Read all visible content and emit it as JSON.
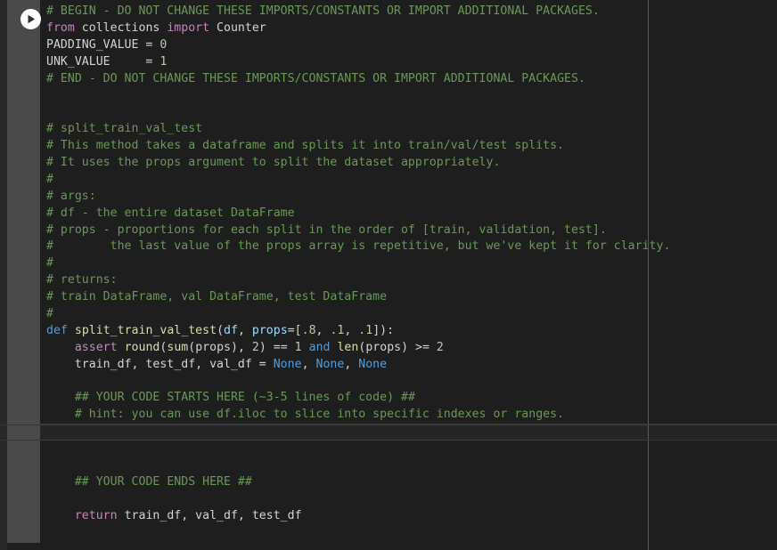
{
  "editor": {
    "theme_background": "#1e1e1e",
    "gutter_background": "#4a4a4a",
    "ruler_color": "#5a5a5a",
    "active_line_background": "#252525",
    "run_button_label": "Run cell",
    "run_icon": "play-icon",
    "colors": {
      "comment": "#6a9955",
      "keyword": "#c586c0",
      "control": "#569cd6",
      "function": "#dcdcaa",
      "parameter": "#9cdcfe",
      "number": "#b5cea8",
      "plain": "#d4d4d4"
    }
  },
  "code": {
    "lines": [
      {
        "id": 1,
        "active": false,
        "tokens": [
          {
            "c": "t-comment",
            "t": "# BEGIN - DO NOT CHANGE THESE IMPORTS/CONSTANTS OR IMPORT ADDITIONAL PACKAGES."
          }
        ]
      },
      {
        "id": 2,
        "active": false,
        "tokens": [
          {
            "c": "t-keyword",
            "t": "from"
          },
          {
            "c": "t-plain",
            "t": " collections "
          },
          {
            "c": "t-keyword",
            "t": "import"
          },
          {
            "c": "t-plain",
            "t": " Counter"
          }
        ]
      },
      {
        "id": 3,
        "active": false,
        "tokens": [
          {
            "c": "t-plain",
            "t": "PADDING_VALUE = "
          },
          {
            "c": "t-num",
            "t": "0"
          }
        ]
      },
      {
        "id": 4,
        "active": false,
        "tokens": [
          {
            "c": "t-plain",
            "t": "UNK_VALUE     = "
          },
          {
            "c": "t-num",
            "t": "1"
          }
        ]
      },
      {
        "id": 5,
        "active": false,
        "tokens": [
          {
            "c": "t-comment",
            "t": "# END - DO NOT CHANGE THESE IMPORTS/CONSTANTS OR IMPORT ADDITIONAL PACKAGES."
          }
        ]
      },
      {
        "id": 6,
        "active": false,
        "tokens": [
          {
            "c": "t-plain",
            "t": ""
          }
        ]
      },
      {
        "id": 7,
        "active": false,
        "tokens": [
          {
            "c": "t-plain",
            "t": ""
          }
        ]
      },
      {
        "id": 8,
        "active": false,
        "tokens": [
          {
            "c": "t-comment",
            "t": "# split_train_val_test"
          }
        ]
      },
      {
        "id": 9,
        "active": false,
        "tokens": [
          {
            "c": "t-comment",
            "t": "# This method takes a dataframe and splits it into train/val/test splits."
          }
        ]
      },
      {
        "id": 10,
        "active": false,
        "tokens": [
          {
            "c": "t-comment",
            "t": "# It uses the props argument to split the dataset appropriately."
          }
        ]
      },
      {
        "id": 11,
        "active": false,
        "tokens": [
          {
            "c": "t-comment",
            "t": "#"
          }
        ]
      },
      {
        "id": 12,
        "active": false,
        "tokens": [
          {
            "c": "t-comment",
            "t": "# args:"
          }
        ]
      },
      {
        "id": 13,
        "active": false,
        "tokens": [
          {
            "c": "t-comment",
            "t": "# df - the entire dataset DataFrame"
          }
        ]
      },
      {
        "id": 14,
        "active": false,
        "tokens": [
          {
            "c": "t-comment",
            "t": "# props - proportions for each split in the order of [train, validation, test]."
          }
        ]
      },
      {
        "id": 15,
        "active": false,
        "tokens": [
          {
            "c": "t-comment",
            "t": "#        the last value of the props array is repetitive, but we've kept it for clarity."
          }
        ]
      },
      {
        "id": 16,
        "active": false,
        "tokens": [
          {
            "c": "t-comment",
            "t": "#"
          }
        ]
      },
      {
        "id": 17,
        "active": false,
        "tokens": [
          {
            "c": "t-comment",
            "t": "# returns:"
          }
        ]
      },
      {
        "id": 18,
        "active": false,
        "tokens": [
          {
            "c": "t-comment",
            "t": "# train DataFrame, val DataFrame, test DataFrame"
          }
        ]
      },
      {
        "id": 19,
        "active": false,
        "tokens": [
          {
            "c": "t-comment",
            "t": "#"
          }
        ]
      },
      {
        "id": 20,
        "active": false,
        "tokens": [
          {
            "c": "t-ctrl",
            "t": "def"
          },
          {
            "c": "t-plain",
            "t": " "
          },
          {
            "c": "t-func",
            "t": "split_train_val_test"
          },
          {
            "c": "t-plain",
            "t": "("
          },
          {
            "c": "t-param",
            "t": "df"
          },
          {
            "c": "t-plain",
            "t": ", "
          },
          {
            "c": "t-param",
            "t": "props"
          },
          {
            "c": "t-plain",
            "t": "=["
          },
          {
            "c": "t-num",
            "t": ".8"
          },
          {
            "c": "t-plain",
            "t": ", "
          },
          {
            "c": "t-num",
            "t": ".1"
          },
          {
            "c": "t-plain",
            "t": ", "
          },
          {
            "c": "t-num",
            "t": ".1"
          },
          {
            "c": "t-plain",
            "t": "]):"
          }
        ]
      },
      {
        "id": 21,
        "active": false,
        "tokens": [
          {
            "c": "t-plain",
            "t": "    "
          },
          {
            "c": "t-keyword",
            "t": "assert"
          },
          {
            "c": "t-plain",
            "t": " "
          },
          {
            "c": "t-func",
            "t": "round"
          },
          {
            "c": "t-plain",
            "t": "("
          },
          {
            "c": "t-func",
            "t": "sum"
          },
          {
            "c": "t-plain",
            "t": "(props), "
          },
          {
            "c": "t-num",
            "t": "2"
          },
          {
            "c": "t-plain",
            "t": ") == "
          },
          {
            "c": "t-num",
            "t": "1"
          },
          {
            "c": "t-plain",
            "t": " "
          },
          {
            "c": "t-ctrl",
            "t": "and"
          },
          {
            "c": "t-plain",
            "t": " "
          },
          {
            "c": "t-func",
            "t": "len"
          },
          {
            "c": "t-plain",
            "t": "(props) >= "
          },
          {
            "c": "t-num",
            "t": "2"
          }
        ]
      },
      {
        "id": 22,
        "active": false,
        "tokens": [
          {
            "c": "t-plain",
            "t": "    train_df, test_df, val_df = "
          },
          {
            "c": "t-ctrl",
            "t": "None"
          },
          {
            "c": "t-plain",
            "t": ", "
          },
          {
            "c": "t-ctrl",
            "t": "None"
          },
          {
            "c": "t-plain",
            "t": ", "
          },
          {
            "c": "t-ctrl",
            "t": "None"
          }
        ]
      },
      {
        "id": 23,
        "active": false,
        "tokens": [
          {
            "c": "t-plain",
            "t": ""
          }
        ]
      },
      {
        "id": 24,
        "active": false,
        "tokens": [
          {
            "c": "t-plain",
            "t": "    "
          },
          {
            "c": "t-comment",
            "t": "## YOUR CODE STARTS HERE (~3-5 lines of code) ##"
          }
        ]
      },
      {
        "id": 25,
        "active": false,
        "tokens": [
          {
            "c": "t-plain",
            "t": "    "
          },
          {
            "c": "t-comment",
            "t": "# hint: you can use df.iloc to slice into specific indexes or ranges."
          }
        ]
      },
      {
        "id": 26,
        "active": true,
        "tokens": [
          {
            "c": "t-plain",
            "t": ""
          }
        ]
      },
      {
        "id": 27,
        "active": false,
        "tokens": [
          {
            "c": "t-plain",
            "t": ""
          }
        ]
      },
      {
        "id": 28,
        "active": false,
        "tokens": [
          {
            "c": "t-plain",
            "t": ""
          }
        ]
      },
      {
        "id": 29,
        "active": false,
        "tokens": [
          {
            "c": "t-plain",
            "t": "    "
          },
          {
            "c": "t-comment",
            "t": "## YOUR CODE ENDS HERE ##"
          }
        ]
      },
      {
        "id": 30,
        "active": false,
        "tokens": [
          {
            "c": "t-plain",
            "t": ""
          }
        ]
      },
      {
        "id": 31,
        "active": false,
        "tokens": [
          {
            "c": "t-plain",
            "t": "    "
          },
          {
            "c": "t-keyword",
            "t": "return"
          },
          {
            "c": "t-plain",
            "t": " train_df, val_df, test_df"
          }
        ]
      },
      {
        "id": 32,
        "active": false,
        "tokens": [
          {
            "c": "t-plain",
            "t": ""
          }
        ]
      }
    ]
  }
}
